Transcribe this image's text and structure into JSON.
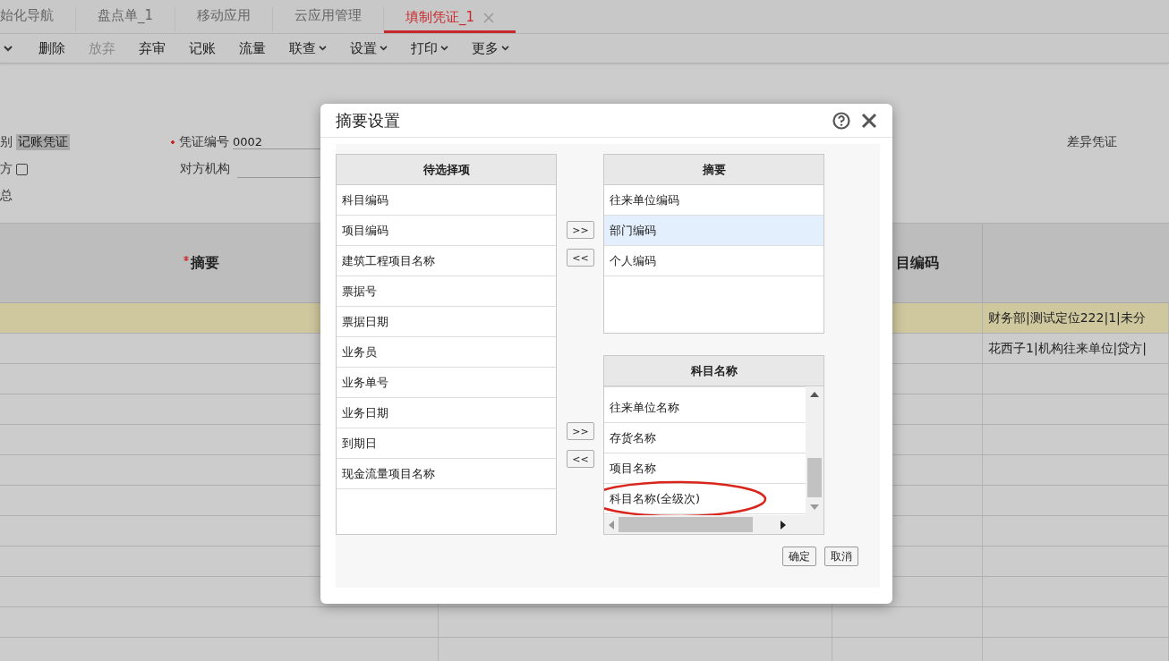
{
  "tabs": [
    {
      "label": "始化导航",
      "selected": false,
      "closable": false
    },
    {
      "label": "盘点单_1",
      "selected": false,
      "closable": false
    },
    {
      "label": "移动应用",
      "selected": false,
      "closable": false
    },
    {
      "label": "云应用管理",
      "selected": false,
      "closable": false
    },
    {
      "label": "填制凭证_1",
      "selected": true,
      "closable": true
    }
  ],
  "toolbar": [
    {
      "label": "删除",
      "disabled": false,
      "dropdown": false
    },
    {
      "label": "放弃",
      "disabled": true,
      "dropdown": false
    },
    {
      "label": "弃审",
      "disabled": false,
      "dropdown": false
    },
    {
      "label": "记账",
      "disabled": false,
      "dropdown": false
    },
    {
      "label": "流量",
      "disabled": false,
      "dropdown": false
    },
    {
      "label": "联查",
      "disabled": false,
      "dropdown": true
    },
    {
      "label": "设置",
      "disabled": false,
      "dropdown": true
    },
    {
      "label": "打印",
      "disabled": false,
      "dropdown": true
    },
    {
      "label": "更多",
      "disabled": false,
      "dropdown": true
    }
  ],
  "form": {
    "type_label": "别",
    "type_value": "记账凭证",
    "number_label": "凭证编号",
    "number_value": "0002",
    "side_label": "方",
    "side_checked": false,
    "org_label": "对方机构",
    "summary_label": "总",
    "diff_label": "差异凭证"
  },
  "table": {
    "columns": [
      {
        "label": "摘要",
        "required": true
      },
      {
        "label": "目编码",
        "required": false
      }
    ],
    "rows": [
      {
        "selected": true,
        "column_4": "财务部|测试定位222|1|未分"
      },
      {
        "selected": false,
        "column_4": "花西子1|机构往来单位|贷方|"
      }
    ]
  },
  "dialog": {
    "title": "摘要设置",
    "available": {
      "title": "待选择项",
      "items": [
        {
          "label": "科目编码",
          "selected": false
        },
        {
          "label": "项目编码",
          "selected": false
        },
        {
          "label": "建筑工程项目名称",
          "selected": false
        },
        {
          "label": "票据号",
          "selected": false
        },
        {
          "label": "票据日期",
          "selected": false
        },
        {
          "label": "业务员",
          "selected": false
        },
        {
          "label": "业务单号",
          "selected": false
        },
        {
          "label": "业务日期",
          "selected": false
        },
        {
          "label": "到期日",
          "selected": false
        },
        {
          "label": "现金流量项目名称",
          "selected": false
        }
      ]
    },
    "move_buttons": [
      ">>",
      "<<"
    ],
    "summary": {
      "title": "摘要",
      "items": [
        {
          "label": "往来单位编码",
          "selected": false
        },
        {
          "label": "部门编码",
          "selected": true
        },
        {
          "label": "个人编码",
          "selected": false
        }
      ]
    },
    "account_name": {
      "title": "科目名称",
      "items": [
        {
          "label": "往来单位名称",
          "selected": false,
          "circled": false
        },
        {
          "label": "存货名称",
          "selected": false,
          "circled": false
        },
        {
          "label": "项目名称",
          "selected": false,
          "circled": false
        },
        {
          "label": "科目名称(全级次)",
          "selected": false,
          "circled": true
        }
      ]
    },
    "buttons": [
      "确定",
      "取消"
    ]
  }
}
